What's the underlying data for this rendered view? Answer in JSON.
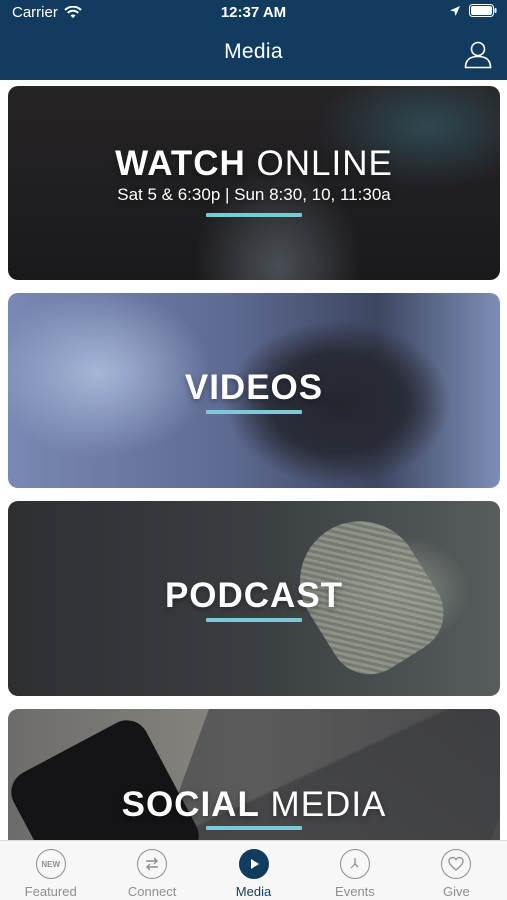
{
  "status_bar": {
    "carrier": "Carrier",
    "time": "12:37 AM"
  },
  "header": {
    "title": "Media"
  },
  "cards": [
    {
      "title_bold": "WATCH",
      "title_thin": " ONLINE",
      "subtitle": "Sat 5 & 6:30p | Sun 8:30, 10, 11:30a"
    },
    {
      "title_bold": "VIDEOS",
      "title_thin": ""
    },
    {
      "title_bold": "PODCAST",
      "title_thin": ""
    },
    {
      "title_bold": "SOCIAL",
      "title_thin": " MEDIA"
    }
  ],
  "tabs": [
    {
      "label": "Featured",
      "icon": "new-badge-icon",
      "badge_text": "NEW"
    },
    {
      "label": "Connect",
      "icon": "swap-arrows-icon"
    },
    {
      "label": "Media",
      "icon": "play-icon",
      "active": true
    },
    {
      "label": "Events",
      "icon": "clock-icon"
    },
    {
      "label": "Give",
      "icon": "heart-icon"
    }
  ],
  "colors": {
    "header": "#123c5f",
    "accent_bar": "#7cc9d8",
    "tab_inactive": "#8e8e8e",
    "tab_active": "#123c5f"
  }
}
